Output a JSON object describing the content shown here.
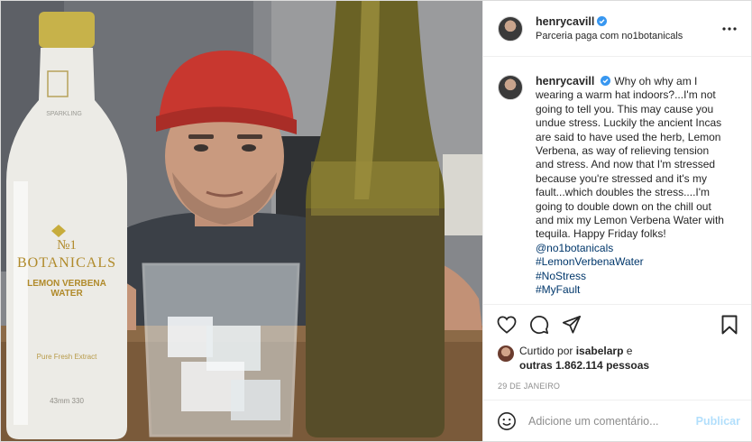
{
  "photo": {
    "bottle_brand_top": "№1",
    "bottle_brand": "BOTANICALS",
    "bottle_flavor_line1": "LEMON VERBENA",
    "bottle_flavor_line2": "WATER",
    "bottle_sparkling": "SPARKLING",
    "bottle_extract": "Pure Fresh Extract",
    "bottle_volume": "43mm   330",
    "colors": {
      "hat": "#c8372f",
      "wall": "#8a8c90",
      "table": "#7a5a3a"
    }
  },
  "header": {
    "username": "henrycavill",
    "subtitle": "Parceria paga com no1botanicals",
    "verified_icon": "verified-badge-icon",
    "more_icon": "more-options-icon"
  },
  "caption": {
    "username": "henrycavill",
    "text": "Why oh why am I wearing a warm hat indoors?...I'm not going to tell you. This may cause you undue stress. Luckily the ancient Incas are said to have used the herb, Lemon Verbena, as way of relieving tension and stress. And now that I'm stressed because you're stressed and it's my fault...which doubles the stress....I'm going to double down on the chill out and mix my Lemon Verbena Water with tequila. Happy Friday folks!",
    "tags": [
      "@no1botanicals",
      "#LemonVerbenaWater",
      "#NoStress",
      "#MyFault"
    ]
  },
  "actions": {
    "like_icon": "heart-icon",
    "comment_icon": "comment-icon",
    "share_icon": "share-icon",
    "save_icon": "bookmark-icon"
  },
  "likes": {
    "prefix": "Curtido por",
    "user": "isabelarp",
    "middle": "e",
    "others": "outras 1.862.114 pessoas"
  },
  "date": "29 DE JANEIRO",
  "comment_bar": {
    "emoji_icon": "smiley-icon",
    "placeholder": "Adicione um comentário...",
    "publish_label": "Publicar"
  },
  "colors": {
    "link": "#00376b",
    "verified": "#3897f0",
    "publish_disabled": "#b2dffc",
    "muted": "#8e8e8e"
  }
}
